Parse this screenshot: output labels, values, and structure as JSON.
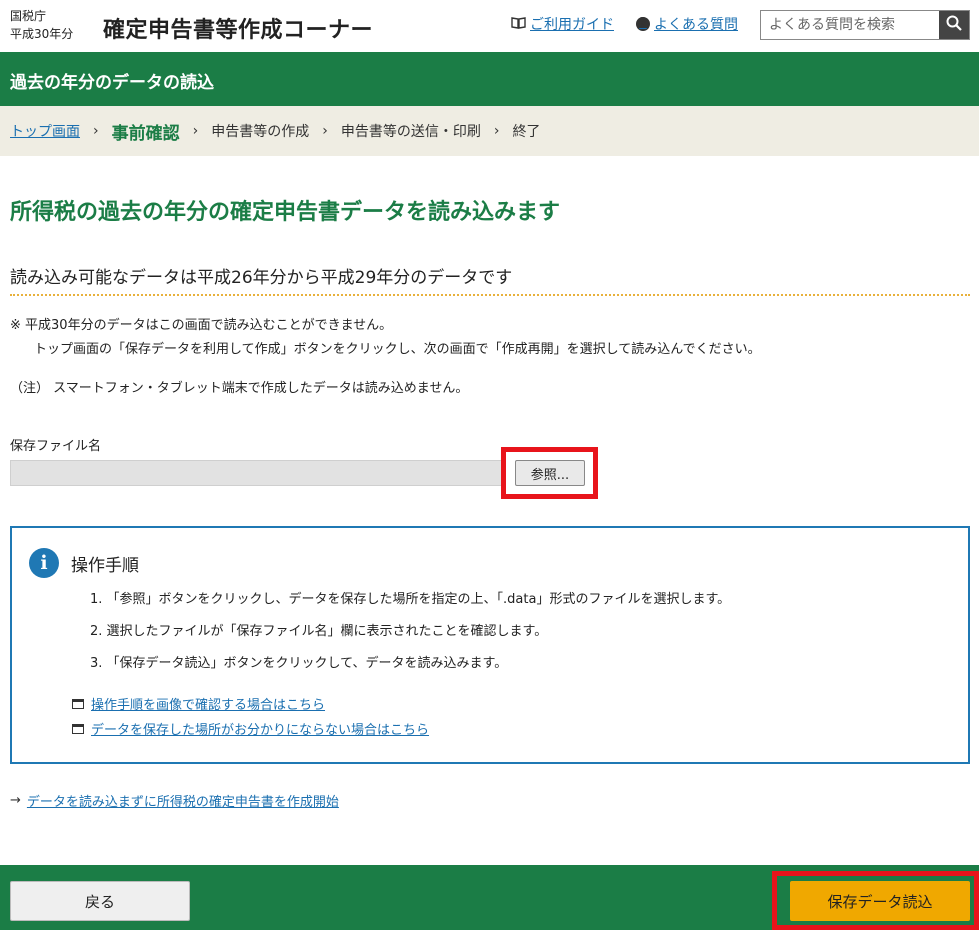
{
  "header": {
    "agency_line1": "国税庁",
    "agency_line2": "平成30年分",
    "site_title": "確定申告書等作成コーナー",
    "guide_label": "ご利用ガイド",
    "faq_label": "よくある質問",
    "search_placeholder": "よくある質問を検索"
  },
  "title_bar": {
    "title": "過去の年分のデータの読込"
  },
  "breadcrumb": {
    "items": [
      "トップ画面",
      "事前確認",
      "申告書等の作成",
      "申告書等の送信・印刷",
      "終了"
    ],
    "separator": "›"
  },
  "main": {
    "heading": "所得税の過去の年分の確定申告書データを読み込みます",
    "subheading": "読み込み可能なデータは平成26年分から平成29年分のデータです",
    "note1_line1": "※  平成30年分のデータはこの画面で読み込むことができません。",
    "note1_line2": "トップ画面の「保存データを利用して作成」ボタンをクリックし、次の画面で「作成再開」を選択して読み込んでください。",
    "note2": "（注） スマートフォン・タブレット端末で作成したデータは読み込めません。",
    "file_label": "保存ファイル名",
    "file_value": "",
    "browse_label": "参照..."
  },
  "instructions": {
    "title": "操作手順",
    "steps": [
      "1.  「参照」ボタンをクリックし、データを保存した場所を指定の上、「.data」形式のファイルを選択します。",
      "2.  選択したファイルが「保存ファイル名」欄に表示されたことを確認します。",
      "3.  「保存データ読込」ボタンをクリックして、データを読み込みます。"
    ],
    "link_a": "操作手順を画像で確認する場合はこちら",
    "link_b": "データを保存した場所がお分かりにならない場合はこちら"
  },
  "start_link": "データを読み込まずに所得税の確定申告書を作成開始",
  "footer": {
    "back_label": "戻る",
    "load_label": "保存データ読込"
  },
  "colors": {
    "brand_green": "#1b7d46",
    "accent_orange": "#f0a800",
    "highlight_red": "#e8141b",
    "info_blue": "#1f78b4"
  }
}
